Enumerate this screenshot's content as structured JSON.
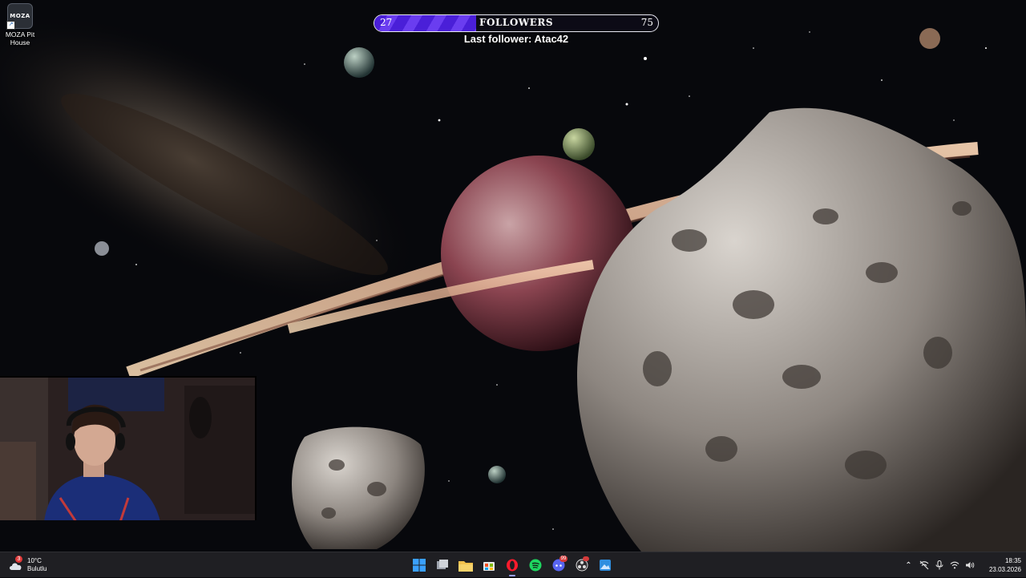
{
  "desktop": {
    "icons": [
      {
        "name": "MOZA Pit House",
        "tile_text": "MOZA"
      }
    ]
  },
  "overlay": {
    "followers": {
      "current": "27",
      "goal": "75",
      "progress": 0.36,
      "title": "FOLLOWERS"
    },
    "last_follower_label": "Last follower:",
    "last_follower_name": "Atac42"
  },
  "webcam": {
    "description_icon": "person-webcam"
  },
  "taskbar": {
    "weather": {
      "temp": "10°C",
      "condition": "Bulutlu",
      "badge": "3",
      "icon": "cloud-icon"
    },
    "apps": [
      {
        "name": "start",
        "icon": "windows-logo-icon"
      },
      {
        "name": "task-view",
        "icon": "task-view-icon"
      },
      {
        "name": "file-explorer",
        "icon": "folder-icon"
      },
      {
        "name": "store",
        "icon": "store-icon"
      },
      {
        "name": "opera",
        "icon": "opera-icon",
        "active": true
      },
      {
        "name": "spotify",
        "icon": "spotify-icon"
      },
      {
        "name": "discord",
        "icon": "discord-icon",
        "badge": "99"
      },
      {
        "name": "obs",
        "icon": "obs-icon"
      },
      {
        "name": "snipping",
        "icon": "image-app-icon"
      }
    ],
    "tray": [
      "chevron-up-icon",
      "network-off-icon",
      "microphone-icon",
      "wifi-icon",
      "speaker-icon"
    ],
    "clock": {
      "time": "18:35",
      "date": "23.03.2026"
    }
  },
  "colors": {
    "progress_fill": "#4a1fd8",
    "taskbar": "#1f1f23"
  }
}
